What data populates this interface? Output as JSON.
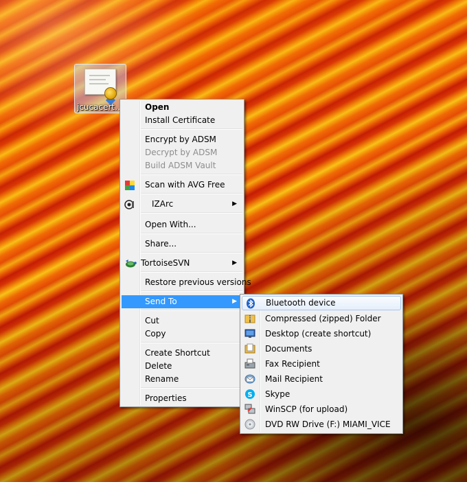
{
  "desktop": {
    "icon_label": "jcucacert.cer"
  },
  "context_menu": {
    "open": "Open",
    "install_certificate": "Install Certificate",
    "encrypt_adsm": "Encrypt by ADSM",
    "decrypt_adsm": "Decrypt by ADSM",
    "build_vault": "Build ADSM Vault",
    "scan_avg": "Scan with AVG Free",
    "izarc": "IZArc",
    "open_with": "Open With...",
    "share": "Share...",
    "tortoisesvn": "TortoiseSVN",
    "restore_versions": "Restore previous versions",
    "send_to": "Send To",
    "cut": "Cut",
    "copy": "Copy",
    "create_shortcut": "Create Shortcut",
    "delete": "Delete",
    "rename": "Rename",
    "properties": "Properties",
    "submenu_arrow": "▶"
  },
  "send_to_menu": {
    "items": [
      {
        "label": "Bluetooth device",
        "icon": "bluetooth-icon"
      },
      {
        "label": "Compressed (zipped) Folder",
        "icon": "zip-folder-icon"
      },
      {
        "label": "Desktop (create shortcut)",
        "icon": "desktop-icon"
      },
      {
        "label": "Documents",
        "icon": "documents-icon"
      },
      {
        "label": "Fax Recipient",
        "icon": "fax-icon"
      },
      {
        "label": "Mail Recipient",
        "icon": "mail-icon"
      },
      {
        "label": "Skype",
        "icon": "skype-icon"
      },
      {
        "label": "WinSCP (for upload)",
        "icon": "winscp-icon"
      },
      {
        "label": "DVD RW Drive (F:) MIAMI_VICE",
        "icon": "dvd-drive-icon"
      }
    ]
  },
  "colors": {
    "menu_bg": "#f0f0f0",
    "selection": "#3399ff",
    "hot_border": "#a8c8ec"
  }
}
